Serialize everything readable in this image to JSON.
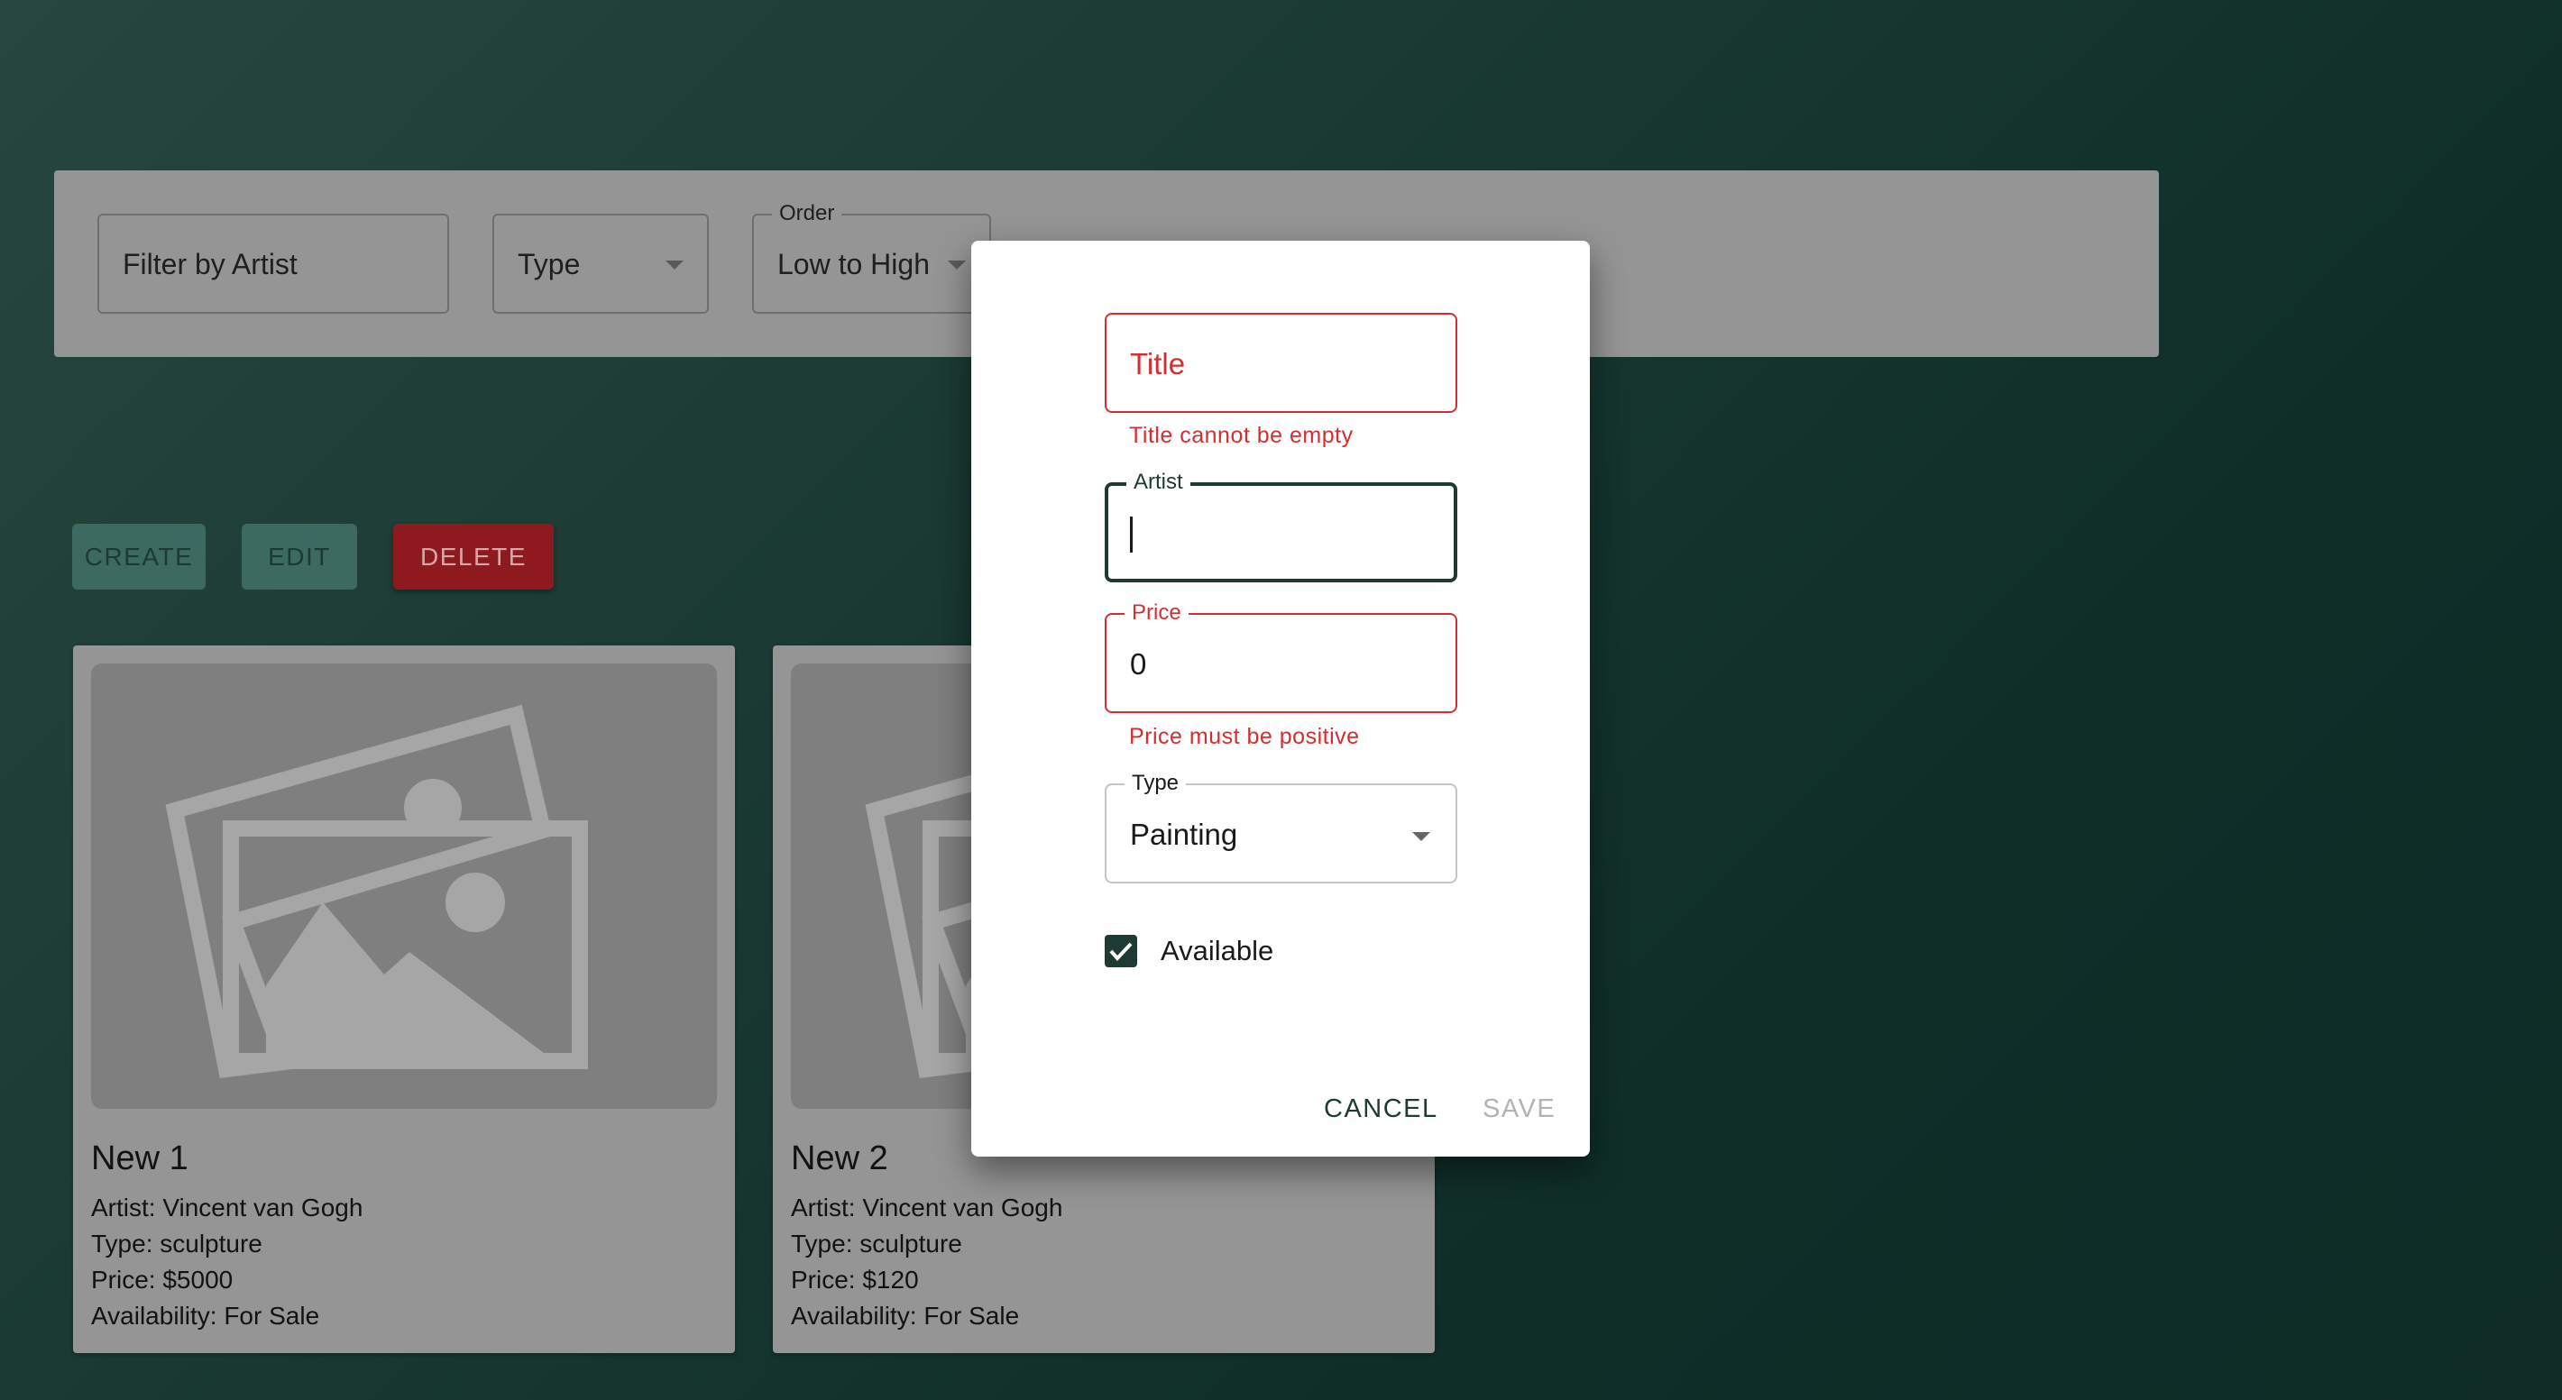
{
  "filters": {
    "artist_placeholder": "Filter by Artist",
    "type_value": "Type",
    "order_label": "Order",
    "order_value": "Low to High"
  },
  "actions": {
    "create": "CREATE",
    "edit": "EDIT",
    "delete": "DELETE"
  },
  "cards": [
    {
      "title": "New 1",
      "artist": "Artist: Vincent van Gogh",
      "type": "Type: sculpture",
      "price": "Price: $5000",
      "availability": "Availability: For Sale"
    },
    {
      "title": "New 2",
      "artist": "Artist: Vincent van Gogh",
      "type": "Type: sculpture",
      "price": "Price: $120",
      "availability": "Availability: For Sale"
    }
  ],
  "dialog": {
    "title_placeholder": "Title",
    "title_error": "Title cannot be empty",
    "artist_label": "Artist",
    "artist_value": "",
    "price_label": "Price",
    "price_value": "0",
    "price_error": "Price must be positive",
    "type_label": "Type",
    "type_value": "Painting",
    "available_label": "Available",
    "available_checked": true,
    "cancel": "CANCEL",
    "save": "SAVE"
  },
  "colors": {
    "error": "#d32f2f",
    "primary": "#1d3a33",
    "delete": "#8e1a1f"
  }
}
